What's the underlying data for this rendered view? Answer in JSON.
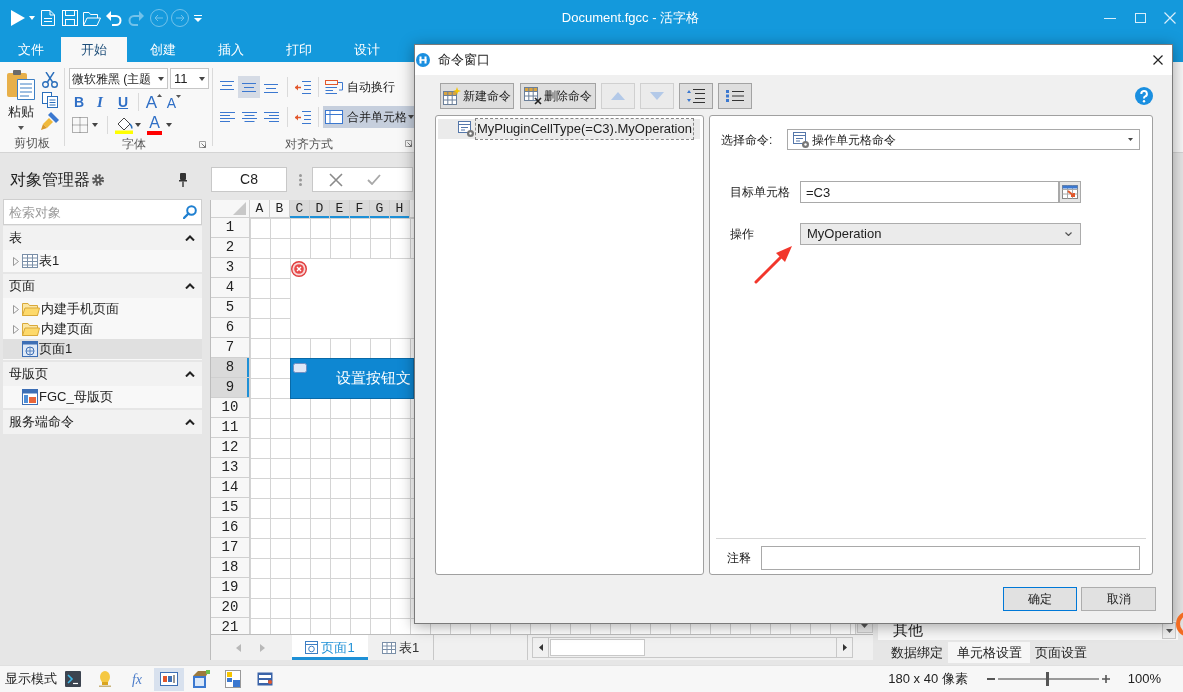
{
  "window": {
    "title": "Document.fgcc - 活字格"
  },
  "quick_access": [
    {
      "kind": "run",
      "disabled": false
    },
    {
      "kind": "dropdown",
      "disabled": false
    },
    {
      "kind": "new",
      "disabled": false
    },
    {
      "kind": "save",
      "disabled": false
    },
    {
      "kind": "open",
      "disabled": false
    },
    {
      "kind": "undo",
      "disabled": false
    },
    {
      "kind": "redo",
      "disabled": true
    },
    {
      "kind": "back",
      "disabled": true
    },
    {
      "kind": "forward",
      "disabled": true
    },
    {
      "kind": "customize",
      "disabled": false
    }
  ],
  "ribbon_tabs": [
    {
      "label": "文件",
      "selected": false
    },
    {
      "label": "开始",
      "selected": true
    },
    {
      "label": "创建",
      "selected": false
    },
    {
      "label": "插入",
      "selected": false
    },
    {
      "label": "打印",
      "selected": false
    },
    {
      "label": "设计",
      "selected": false
    }
  ],
  "ribbon": {
    "clipboard": {
      "paste": "粘贴",
      "group_label": "剪切板"
    },
    "font": {
      "family": "微软雅黑 (主题",
      "size": "11",
      "styles": [
        {
          "kind": "bold",
          "glyph": "B"
        },
        {
          "kind": "italic",
          "glyph": "I"
        },
        {
          "kind": "underline",
          "glyph": "U"
        }
      ],
      "sizers": [
        {
          "kind": "grow",
          "glyph": "A"
        },
        {
          "kind": "shrink",
          "glyph": "A"
        }
      ],
      "font_color_glyph": "A",
      "group_label": "字体"
    },
    "alignment": {
      "vertical": [
        {
          "kind": "top",
          "selected": false
        },
        {
          "kind": "middle",
          "selected": true
        },
        {
          "kind": "bottom",
          "selected": false
        }
      ],
      "horizontal": [
        {
          "kind": "left",
          "selected": false
        },
        {
          "kind": "center",
          "selected": false
        },
        {
          "kind": "right",
          "selected": false
        }
      ],
      "wrap": {
        "label": "自动换行",
        "selected": false
      },
      "merge": {
        "label": "合并单元格",
        "selected": true
      },
      "group_label": "对齐方式"
    }
  },
  "object_manager": {
    "title": "对象管理器",
    "search": {
      "placeholder": "检索对象"
    },
    "sections": [
      {
        "label": "表",
        "expanded": true,
        "items": [
          {
            "label": "表1",
            "kind": "table",
            "expander": true,
            "selected": false
          }
        ]
      },
      {
        "label": "页面",
        "expanded": true,
        "items": [
          {
            "label": "内建手机页面",
            "kind": "folder",
            "expander": true,
            "selected": false
          },
          {
            "label": "内建页面",
            "kind": "folder",
            "expander": true,
            "selected": false
          },
          {
            "label": "页面1",
            "kind": "page",
            "expander": false,
            "selected": true
          }
        ]
      },
      {
        "label": "母版页",
        "expanded": true,
        "items": [
          {
            "label": "FGC_母版页",
            "kind": "master",
            "expander": false,
            "selected": false
          }
        ]
      },
      {
        "label": "服务端命令",
        "expanded": true
      }
    ]
  },
  "formula_bar": {
    "cell_ref": "C8"
  },
  "sheet": {
    "columns": [
      {
        "label": "A",
        "selected": false
      },
      {
        "label": "B",
        "selected": false
      },
      {
        "label": "C",
        "selected": true
      },
      {
        "label": "D",
        "selected": true
      },
      {
        "label": "E",
        "selected": true
      },
      {
        "label": "F",
        "selected": true
      },
      {
        "label": "G",
        "selected": true
      },
      {
        "label": "H",
        "selected": true
      }
    ],
    "rows": [
      {
        "label": "1",
        "selected": false
      },
      {
        "label": "2",
        "selected": false
      },
      {
        "label": "3",
        "selected": false
      },
      {
        "label": "4",
        "selected": false
      },
      {
        "label": "5",
        "selected": false
      },
      {
        "label": "6",
        "selected": false
      },
      {
        "label": "7",
        "selected": false
      },
      {
        "label": "8",
        "selected": true
      },
      {
        "label": "9",
        "selected": true
      },
      {
        "label": "10",
        "selected": false
      },
      {
        "label": "11",
        "selected": false
      },
      {
        "label": "12",
        "selected": false
      },
      {
        "label": "13",
        "selected": false
      },
      {
        "label": "14",
        "selected": false
      },
      {
        "label": "15",
        "selected": false
      },
      {
        "label": "16",
        "selected": false
      },
      {
        "label": "17",
        "selected": false
      },
      {
        "label": "18",
        "selected": false
      },
      {
        "label": "19",
        "selected": false
      },
      {
        "label": "20",
        "selected": false
      },
      {
        "label": "21",
        "selected": false
      }
    ],
    "button_cell": {
      "label": "设置按钮文"
    },
    "tabs": [
      {
        "label": "页面1",
        "kind": "page",
        "selected": true
      },
      {
        "label": "表1",
        "kind": "table",
        "selected": false
      }
    ]
  },
  "property_panel": {
    "category": "其他",
    "tabs": [
      {
        "label": "数据绑定",
        "selected": false
      },
      {
        "label": "单元格设置",
        "selected": true
      },
      {
        "label": "页面设置",
        "selected": false
      }
    ]
  },
  "dialog": {
    "title": "命令窗口",
    "toolbar": [
      {
        "kind": "new",
        "label": "新建命令",
        "disabled": false
      },
      {
        "kind": "delete",
        "label": "删除命令",
        "disabled": false
      },
      {
        "kind": "move_up",
        "disabled": true
      },
      {
        "kind": "move_down",
        "disabled": true
      },
      {
        "kind": "indent",
        "disabled": false
      },
      {
        "kind": "outdent",
        "disabled": false
      }
    ],
    "commands": [
      {
        "label": "MyPluginCellType(=C3).MyOperation",
        "selected": true
      }
    ],
    "command_select": {
      "label": "选择命令:",
      "value": "操作单元格命令"
    },
    "target_cell": {
      "label": "目标单元格",
      "value": "=C3"
    },
    "operation": {
      "label": "操作",
      "value": "MyOperation"
    },
    "comment": {
      "label": "注释"
    },
    "buttons": [
      {
        "label": "确定",
        "default": true
      },
      {
        "label": "取消",
        "default": false
      }
    ]
  },
  "status_bar": {
    "mode_label": "显示模式",
    "tools": [
      {
        "kind": "console",
        "selected": false
      },
      {
        "kind": "bulb",
        "selected": false
      },
      {
        "kind": "formula",
        "glyph": "fx",
        "selected": false
      },
      {
        "kind": "textbox",
        "selected": true
      },
      {
        "kind": "package",
        "selected": false
      },
      {
        "kind": "grid",
        "selected": false
      },
      {
        "kind": "form",
        "selected": false
      }
    ],
    "size": "180 x 40 像素",
    "zoom": {
      "level": 0.49,
      "reading": "100%"
    }
  }
}
